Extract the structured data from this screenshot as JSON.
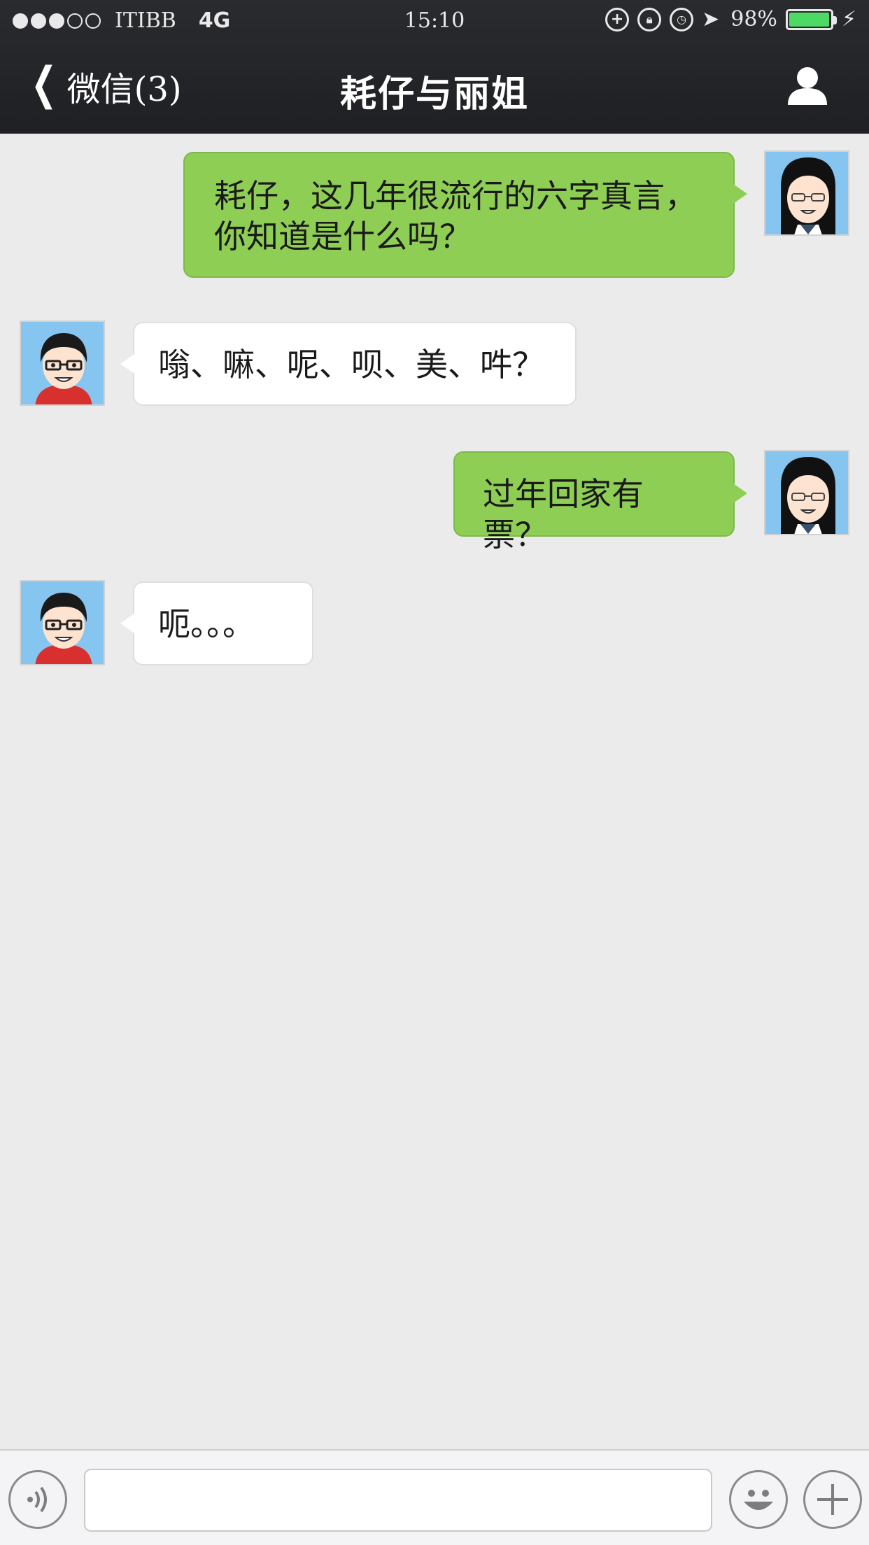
{
  "status_bar": {
    "carrier": "ITIBB",
    "network": "4G",
    "time": "15:10",
    "battery_percent": "98%",
    "battery_level": 0.98,
    "signal_bars_filled": 3,
    "signal_bars_total": 5
  },
  "nav": {
    "back_label": "微信(3)",
    "title": "耗仔与丽姐"
  },
  "messages": [
    {
      "sender": "me",
      "lines": [
        "耗仔，这几年很流行的六字真言，",
        "你知道是什么吗？"
      ]
    },
    {
      "sender": "them",
      "lines": [
        "嗡、嘛、呢、呗、美、吽？"
      ]
    },
    {
      "sender": "me",
      "lines": [
        "过年回家有票？"
      ]
    },
    {
      "sender": "them",
      "lines": [
        "呃。。。"
      ]
    }
  ],
  "input_bar": {
    "text_value": "",
    "placeholder": ""
  },
  "colors": {
    "nav_bg": "#1f2024",
    "chat_bg": "#ebebeb",
    "my_bubble": "#8fce54",
    "their_bubble": "#ffffff",
    "avatar_bg": "#86c5f0"
  }
}
